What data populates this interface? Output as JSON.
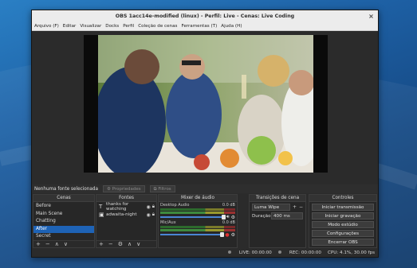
{
  "window": {
    "title": "OBS 1acc14e-modified (linux) - Perfil: Live - Cenas: Live Coding",
    "close_glyph": "×"
  },
  "menu": [
    "Arquivo (F)",
    "Editar",
    "Visualizar",
    "Docks",
    "Perfil",
    "Coleção de cenas",
    "Ferramentas (T)",
    "Ajuda (H)"
  ],
  "source_toolbar": {
    "no_source": "Nenhuma fonte selecionada",
    "properties": "Propriedades",
    "filters": "Filtros"
  },
  "scenes": {
    "title": "Cenas",
    "items": [
      "Before",
      "Main Scene",
      "Chatting",
      "After",
      "Secret"
    ],
    "selected": "After"
  },
  "sources": {
    "title": "Fontes",
    "items": [
      {
        "name": "thanks for watching",
        "icon": "text-icon"
      },
      {
        "name": "adwaita-night",
        "icon": "image-icon"
      }
    ]
  },
  "mixer": {
    "title": "Mixer de áudio",
    "channels": [
      {
        "name": "Desktop Audio",
        "db": "0.0 dB",
        "muted": false
      },
      {
        "name": "Mic/Aux",
        "db": "0.0 dB",
        "muted": true
      }
    ]
  },
  "transitions": {
    "title": "Transições de cena",
    "selected": "Luma Wipe",
    "duration_label": "Duração",
    "duration_value": "400 ms"
  },
  "controls": {
    "title": "Controles",
    "buttons": [
      "Iniciar transmissão",
      "Iniciar gravação",
      "Modo estúdio",
      "Configurações",
      "Encerrar OBS"
    ]
  },
  "status": {
    "live": "LIVE: 00:00:00",
    "rec": "REC: 00:00:00",
    "cpu": "CPU: 4.1%, 30.00 fps"
  },
  "colors": {
    "selection": "#1e63b6",
    "desktop": "#1d5fa3",
    "panel_bg": "#272727"
  }
}
